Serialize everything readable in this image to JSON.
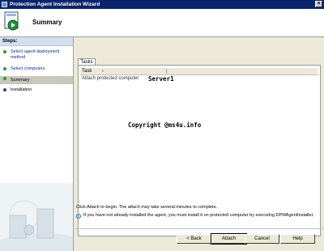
{
  "window": {
    "title": "Protection Agent Installation Wizard",
    "close_glyph": "×"
  },
  "header": {
    "title": "Summary",
    "icon": "wizard-install-icon"
  },
  "steps": {
    "heading": "Steps:",
    "items": [
      {
        "label": "Select agent deployment method",
        "state": "done"
      },
      {
        "label": "Select computers",
        "state": "done"
      },
      {
        "label": "Summary",
        "state": "current"
      },
      {
        "label": "Installation",
        "state": "pending"
      }
    ]
  },
  "tabs": [
    {
      "label": "Tasks"
    }
  ],
  "grid": {
    "column": "Task",
    "rows": [
      {
        "task": "Attach protected computer",
        "value": "Server1"
      }
    ]
  },
  "watermark": "Copyright @ms4u.info",
  "info": {
    "line1": "Click Attach to begin. The attach may take several minutes to complete.",
    "line2": "If you have not already installed the agent, you must install it on protected computer by executing DPMAgentInstaller."
  },
  "buttons": {
    "back": "< Back",
    "attach": "Attach",
    "cancel": "Cancel",
    "help": "Help"
  },
  "colors": {
    "titlebar": "#0a246a",
    "step_done": "#2c9a2c",
    "step_pending": "#2a3fa3"
  }
}
